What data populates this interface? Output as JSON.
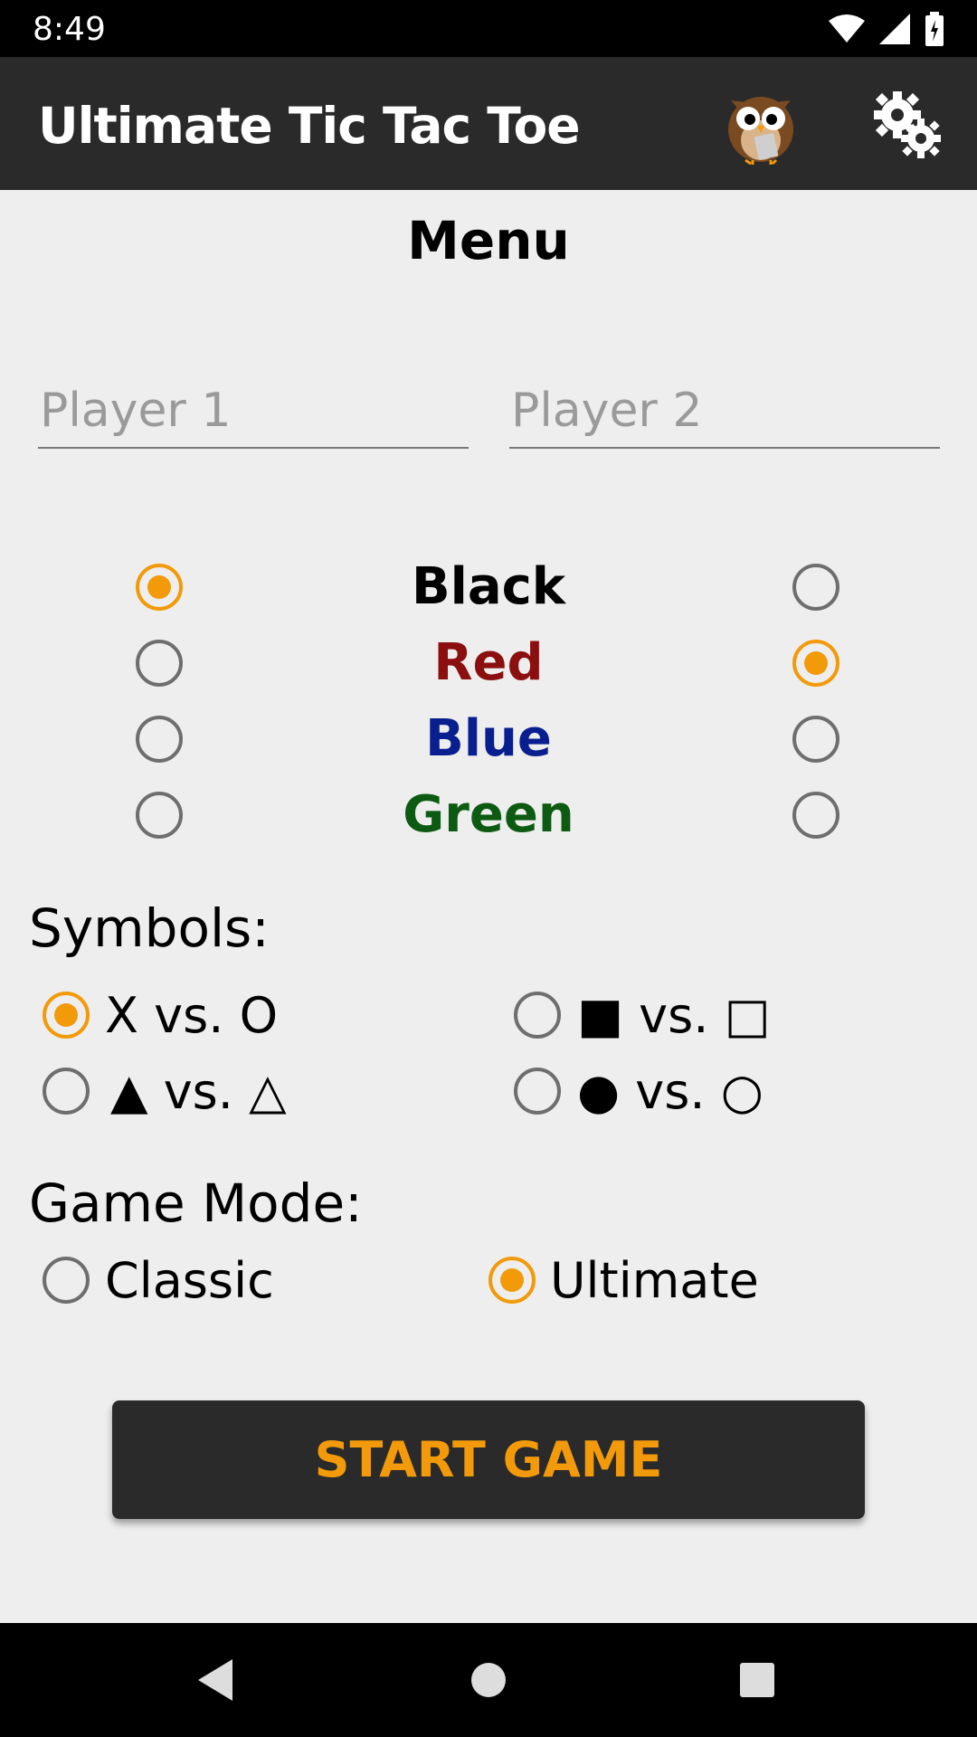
{
  "status_bar": {
    "time": "8:49",
    "icons": [
      "wifi-icon",
      "signal-icon",
      "battery-icon"
    ]
  },
  "app_bar": {
    "title": "Ultimate Tic Tac Toe",
    "owl_icon": "owl-icon",
    "settings_icon": "gear-icon"
  },
  "menu": {
    "title": "Menu"
  },
  "players": {
    "player1": {
      "placeholder": "Player 1",
      "value": ""
    },
    "player2": {
      "placeholder": "Player 2",
      "value": ""
    }
  },
  "colors": {
    "options": [
      {
        "label": "Black",
        "color": "#000000",
        "player1_selected": true,
        "player2_selected": false
      },
      {
        "label": "Red",
        "color": "#8b0f0f",
        "player1_selected": false,
        "player2_selected": true
      },
      {
        "label": "Blue",
        "color": "#0a1f8f",
        "player1_selected": false,
        "player2_selected": false
      },
      {
        "label": "Green",
        "color": "#0d5a12",
        "player1_selected": false,
        "player2_selected": false
      }
    ]
  },
  "symbols": {
    "heading": "Symbols:",
    "options": [
      {
        "label": "X vs. O",
        "selected": true
      },
      {
        "label": "■ vs. □",
        "selected": false
      },
      {
        "label": "▲ vs.  △",
        "selected": false
      },
      {
        "label": "● vs. ○",
        "selected": false
      }
    ]
  },
  "game_mode": {
    "heading": "Game Mode:",
    "options": [
      {
        "label": "Classic",
        "selected": false
      },
      {
        "label": "Ultimate",
        "selected": true
      }
    ]
  },
  "start_button": {
    "label": "START GAME"
  },
  "nav_bar": {
    "icons": [
      "back-icon",
      "home-icon",
      "recents-icon"
    ]
  },
  "theme": {
    "accent": "#f29a0a",
    "bar": "#2a2a2a",
    "background": "#eeeeee"
  }
}
